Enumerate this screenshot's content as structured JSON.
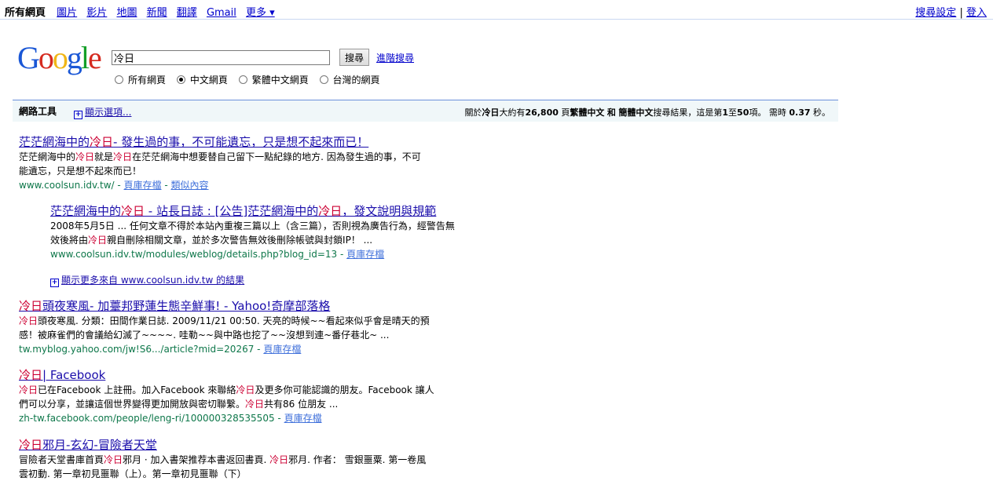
{
  "topnav": {
    "current": "所有網頁",
    "links": [
      "圖片",
      "影片",
      "地圖",
      "新聞",
      "翻譯",
      "Gmail",
      "更多 ▾"
    ],
    "right_settings": "搜尋設定",
    "separator": "|",
    "right_login": "登入"
  },
  "logo": {
    "letters": [
      "G",
      "o",
      "o",
      "g",
      "l",
      "e"
    ]
  },
  "search": {
    "query": "冷日",
    "button": "搜尋",
    "advanced": "進階搜尋"
  },
  "radios": [
    {
      "label": "所有網頁",
      "checked": false
    },
    {
      "label": "中文網頁",
      "checked": true
    },
    {
      "label": "繁體中文網頁",
      "checked": false
    },
    {
      "label": "台灣的網頁",
      "checked": false
    }
  ],
  "tools": {
    "label": "網路工具",
    "options": "顯示選項...",
    "stats": "關於冷日大約有26,800 頁繁體中文 和 簡體中文搜尋結果，這是第1至50項。 需時 0.37 秒。"
  },
  "results": [
    {
      "title": "茫茫網海中的冷日- 發生過的事，不可能遺忘，只是想不起來而已！",
      "snippet1": "茫茫網海中的冷日就是冷日在茫茫網海中想要替自己留下一點紀錄的地方. 因為發生過的事，不可",
      "snippet2": "能遺忘，只是想不起來而已！",
      "url": "www.coolsun.idv.tw/",
      "cache": "頁庫存檔",
      "similar": "類似內容"
    },
    {
      "title": "茫茫網海中的冷日 - 站長日誌 : [公告]茫茫網海中的冷日，發文說明與規範",
      "snippet1": "2008年5月5日 ... 任何文章不得於本站內重複三篇以上（含三篇），否則視為廣告行為，經警告無",
      "snippet2": "效後將由冷日親自刪除相關文章，並於多次警告無效後刪除帳號與封鎖IP！ ...",
      "url": "www.coolsun.idv.tw/modules/weblog/details.php?blog_id=13",
      "cache": "頁庫存檔"
    },
    {
      "more_results": "顯示更多來自 www.coolsun.idv.tw 的結果"
    },
    {
      "title": "冷日頭夜寒風- 加薹邦野蓮生態辛鮮事! - Yahoo!奇摩部落格",
      "snippet1": "冷日頭夜寒風. 分類：田間作業日誌. 2009/11/21 00:50. 天亮的時候~~看起來似乎會是晴天的預",
      "snippet2": "感！被麻雀們的會議給幻滅了~~~~. 哇勒~~與中路也挖了~~沒想到連~番仔巷北~ ...",
      "url": "tw.myblog.yahoo.com/jw!S6.../article?mid=20267",
      "cache": "頁庫存檔"
    },
    {
      "title": "冷日| Facebook",
      "snippet1": "冷日已在Facebook 上註冊。加入Facebook 來聯絡冷日及更多你可能認識的朋友。Facebook 讓人",
      "snippet2": "們可以分享，並讓這個世界變得更加開放與密切聯繫。冷日共有86 位朋友 ...",
      "url": "zh-tw.facebook.com/people/leng-ri/100000328535505",
      "cache": "頁庫存檔"
    },
    {
      "title": "冷日邪月-玄幻-冒險者天堂",
      "snippet1": "冒險者天堂書庫首頁冷日邪月 · 加入書架推荐本書返回書頁. 冷日邪月. 作者： 雪銀噩粟. 第一卷風",
      "snippet2": "雲初動. 第一章初見噩聯（上）。第一章初見噩聯（下）"
    }
  ],
  "colors": {
    "link": "#1a0dab",
    "url": "#0e774a",
    "keyword": "#cc0033",
    "toolbar_bg": "#f0f7f9"
  }
}
